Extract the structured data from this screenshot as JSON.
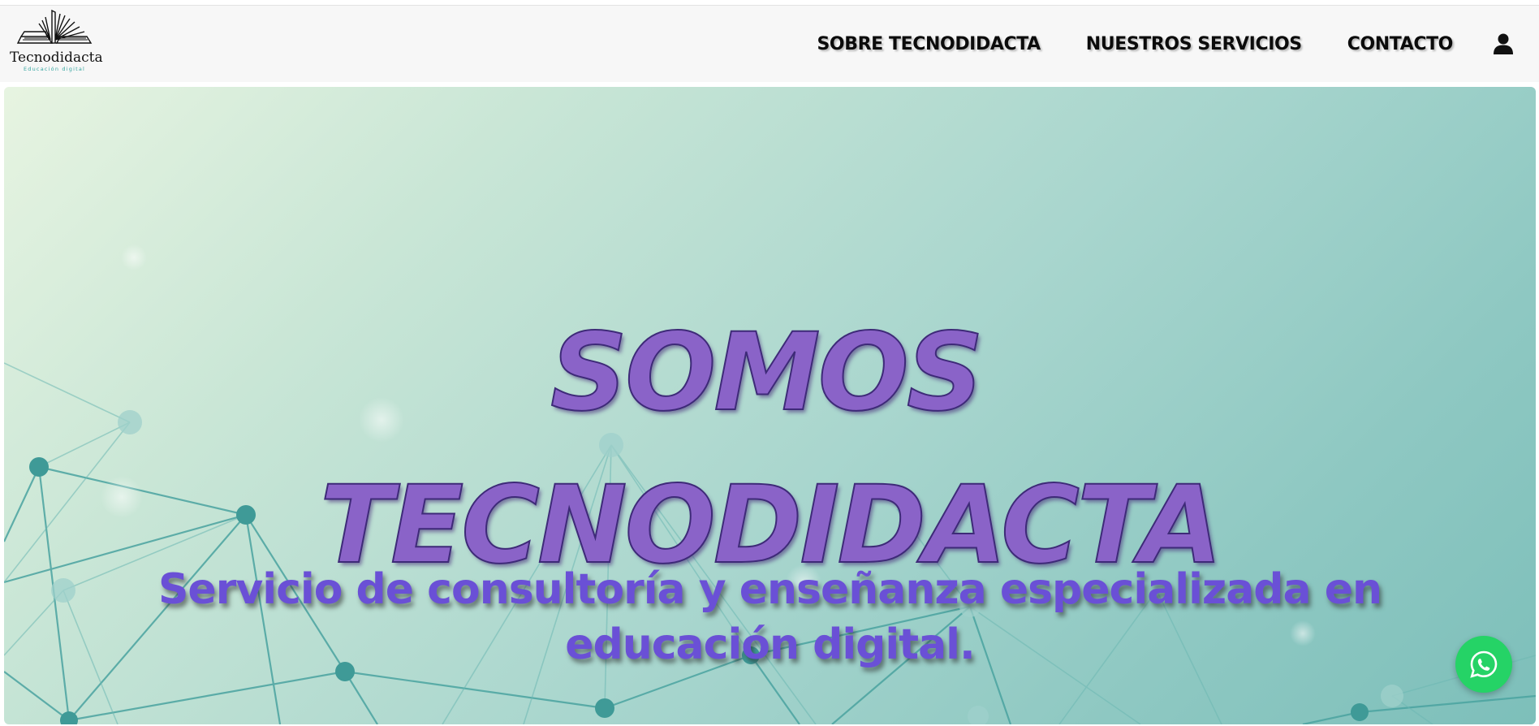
{
  "brand": {
    "name": "Tecnodidacta",
    "tagline": "Educación digital"
  },
  "nav": {
    "items": [
      {
        "label": "SOBRE TECNODIDACTA"
      },
      {
        "label": "NUESTROS SERVICIOS"
      },
      {
        "label": "CONTACTO"
      }
    ],
    "user_icon": "user-icon"
  },
  "hero": {
    "title_line1": "SOMOS",
    "title_line2": "TECNODIDACTA",
    "subtitle_line1": "Servicio de consultoría y enseñanza especializada en",
    "subtitle_line2": "educación digital."
  },
  "floating": {
    "whatsapp_icon": "whatsapp-icon"
  },
  "colors": {
    "title": "#8a63c8",
    "subtitle": "#6a50d6",
    "whatsapp": "#25d366",
    "network": "#4aa3a0"
  }
}
